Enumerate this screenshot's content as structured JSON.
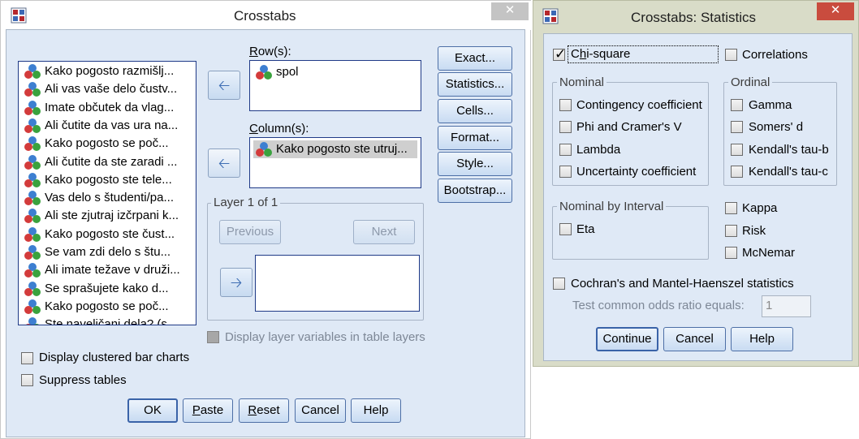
{
  "crosstabs": {
    "title": "Crosstabs",
    "close": "✕",
    "variables": [
      "Kako pogosto razmišlj...",
      "Ali vas vaše delo čustv...",
      "Imate občutek da vlag...",
      "Ali čutite da vas ura na...",
      "Kako pogosto se poč...",
      "Ali čutite da ste zaradi ...",
      "Kako pogosto ste tele...",
      "Vas delo s študenti/pa...",
      "Ali ste zjutraj izčrpani k...",
      "Kako pogosto ste čust...",
      "Se vam zdi delo s štu...",
      "Ali imate težave v druži...",
      "Se sprašujete kako d...",
      "Kako pogosto se poč...",
      "Ste naveličani dela? (s..."
    ],
    "rows_label": "Row(s):",
    "rows": [
      "spol"
    ],
    "columns_label": "Column(s):",
    "columns": [
      "Kako pogosto ste utruj..."
    ],
    "layer_title": "Layer 1 of 1",
    "previous": "Previous",
    "next": "Next",
    "display_layer_vars": "Display layer variables in table layers",
    "display_clustered": "Display clustered bar charts",
    "suppress_tables": "Suppress tables",
    "side_buttons": [
      "Exact...",
      "Statistics...",
      "Cells...",
      "Format...",
      "Style...",
      "Bootstrap..."
    ],
    "ok": "OK",
    "paste": "Paste",
    "reset": "Reset",
    "cancel": "Cancel",
    "help": "Help"
  },
  "statistics": {
    "title": "Crosstabs: Statistics",
    "close": "✕",
    "chi_square": "Chi-square",
    "correlations": "Correlations",
    "nominal_title": "Nominal",
    "nominal": [
      "Contingency coefficient",
      "Phi and Cramer's V",
      "Lambda",
      "Uncertainty coefficient"
    ],
    "ordinal_title": "Ordinal",
    "ordinal": [
      "Gamma",
      "Somers' d",
      "Kendall's tau-b",
      "Kendall's tau-c"
    ],
    "nbi_title": "Nominal by Interval",
    "eta": "Eta",
    "kappa": "Kappa",
    "risk": "Risk",
    "mcnemar": "McNemar",
    "cochran": "Cochran's and Mantel-Haenszel statistics",
    "test_odds": "Test common odds ratio equals:",
    "test_odds_value": "1",
    "continue": "Continue",
    "cancel": "Cancel",
    "help": "Help"
  }
}
